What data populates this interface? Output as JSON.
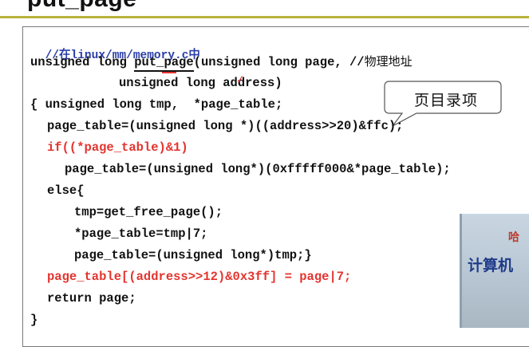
{
  "slide": {
    "title": "put_page",
    "callout": "页目录项",
    "photo_text_top": "哈",
    "photo_text_main": "计算机"
  },
  "code": {
    "l1": "//在linux/mm/memory.c中",
    "l2_pre": "unsigned long ",
    "l2_fn": "put_page",
    "l2_post": "(unsigned long page, //",
    "l2_comment": "物理地址",
    "l3": "unsigned long address)",
    "l4": "{ unsigned long tmp,  *page_table;",
    "l5": "page_table=(unsigned long *)((address>>20)&ffc);",
    "l6_pre": "if",
    "l6_red": "((*page_table)&1)",
    "l7": "page_table=(unsigned long*)(0xfffff000&*page_table);",
    "l8": "else{",
    "l9": "tmp=get_free_page();",
    "l10": "*page_table=tmp|7;",
    "l11": "page_table=(unsigned long*)tmp;}",
    "l12": "page_table[(address>>12)&0x3ff] = page|7;",
    "l13": "return page;",
    "l14": "}"
  }
}
